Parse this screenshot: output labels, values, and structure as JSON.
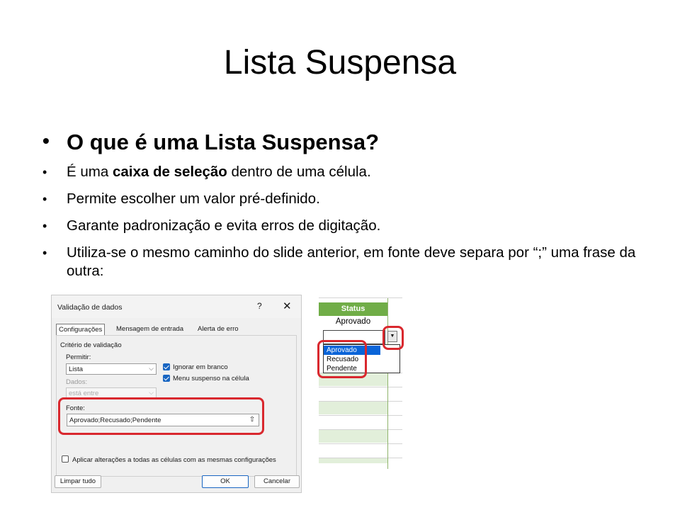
{
  "slide": {
    "title": "Lista Suspensa",
    "bullet_char": "•",
    "main_question": "O que é uma Lista Suspensa?",
    "b1_pre": "É uma ",
    "b1_bold": "caixa de seleção",
    "b1_post": " dentro de uma célula.",
    "b2": "Permite escolher um valor pré-definido.",
    "b3": "Garante padronização e evita erros de digitação.",
    "b4": "Utiliza-se o mesmo caminho do slide anterior, em fonte deve separa por “;” uma frase da outra:"
  },
  "dialog": {
    "title": "Validação de dados",
    "help": "?",
    "close": "✕",
    "tabs": [
      "Configurações",
      "Mensagem de entrada",
      "Alerta de erro"
    ],
    "criteria_label": "Critério de validação",
    "allow_label": "Permitir:",
    "allow_value": "Lista",
    "data_label": "Dados:",
    "data_value": "está entre",
    "ignore_blank": "Ignorar em branco",
    "in_cell_dropdown": "Menu suspenso na célula",
    "source_label": "Fonte:",
    "source_value": "Aprovado;Recusado;Pendente",
    "apply_all": "Aplicar alterações a todas as células com as mesmas configurações",
    "clear_all": "Limpar tudo",
    "ok": "OK",
    "cancel": "Cancelar"
  },
  "sheet": {
    "header": "Status",
    "cell_value": "Aprovado",
    "options": [
      "Aprovado",
      "Recusado",
      "Pendente"
    ],
    "selected_option": "Aprovado",
    "header_color": "#70ad47",
    "band_color": "#e2efda"
  },
  "colors": {
    "highlight": "#d9282e",
    "accent": "#1966c2"
  }
}
